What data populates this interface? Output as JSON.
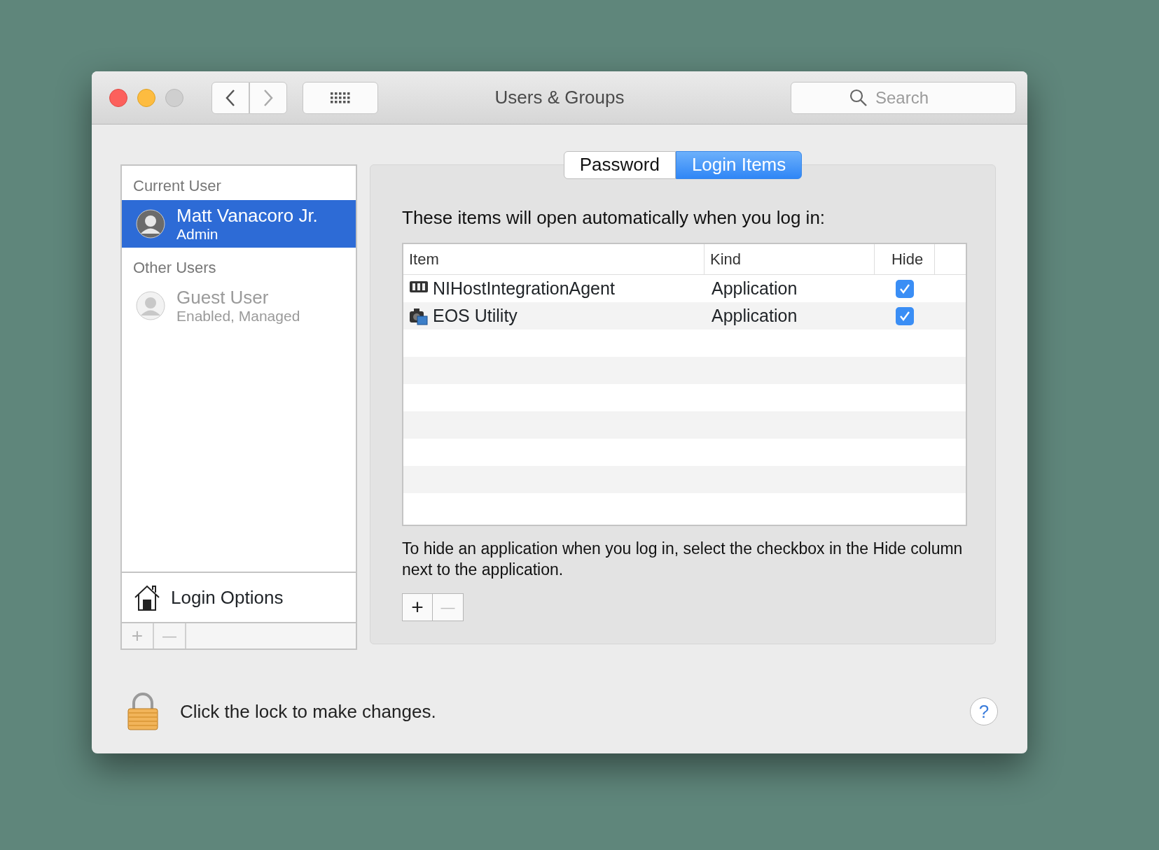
{
  "window": {
    "title": "Users & Groups"
  },
  "toolbar": {
    "search": {
      "placeholder": "Search"
    }
  },
  "sidebar": {
    "sections": [
      {
        "heading": "Current User",
        "users": [
          {
            "name": "Matt Vanacoro Jr.",
            "role": "Admin",
            "selected": true,
            "disabled": false
          }
        ]
      },
      {
        "heading": "Other Users",
        "users": [
          {
            "name": "Guest User",
            "role": "Enabled, Managed",
            "selected": false,
            "disabled": true
          }
        ]
      }
    ],
    "login_options": "Login Options",
    "buttons": [
      {
        "label": "+",
        "disabled": true
      },
      {
        "label": "—",
        "disabled": true
      }
    ]
  },
  "tabs": [
    {
      "label": "Password",
      "selected": false
    },
    {
      "label": "Login Items",
      "selected": true
    }
  ],
  "login_items": {
    "intro": "These items will open automatically when you log in:",
    "columns": [
      "Item",
      "Kind",
      "Hide"
    ],
    "rows": [
      {
        "name": "NIHostIntegrationAgent",
        "kind": "Application",
        "hide": true
      },
      {
        "name": "EOS Utility",
        "kind": "Application",
        "hide": true
      }
    ],
    "hint": "To hide an application when you log in, select the checkbox in the Hide column next to the application.",
    "buttons": [
      {
        "label": "+",
        "disabled": false
      },
      {
        "label": "—",
        "disabled": true
      }
    ]
  },
  "lock": {
    "text": "Click the lock to make changes."
  },
  "help": "?"
}
